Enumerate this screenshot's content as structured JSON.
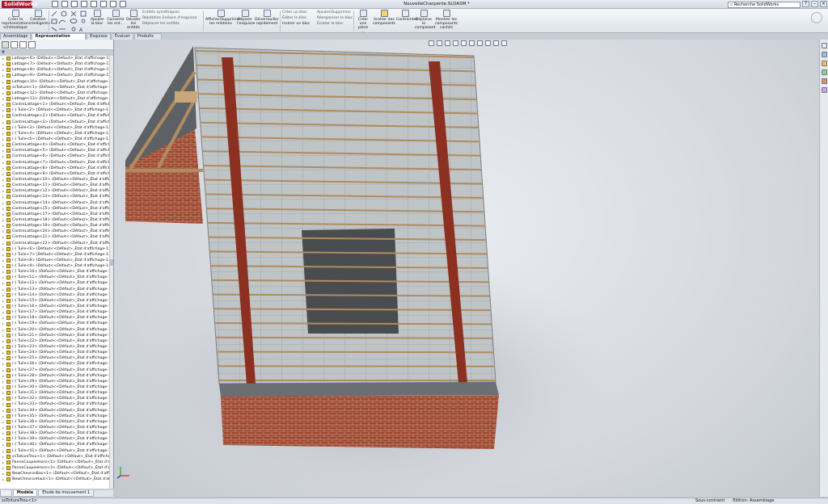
{
  "app": {
    "brand": "SolidWorks",
    "document_title": "NouvelleCharpente.SLDASM *",
    "search_placeholder": "Recherche SolidWorks"
  },
  "ribbon": {
    "buttons": [
      {
        "label": "Créer la représentation schématique"
      },
      {
        "label": "Cotation intelligente"
      },
      {
        "label": "Ajouter la bloc"
      },
      {
        "label": "Convertir les ent..."
      },
      {
        "label": "Décaler les entités"
      },
      {
        "label": "Afficher/Supprimer les relations"
      },
      {
        "label": "Réparer l'esquisse"
      },
      {
        "label": "Déverrouiller rapidement"
      },
      {
        "label": "Créer une pièce ..."
      },
      {
        "label": "Insérer des composants"
      },
      {
        "label": "Contraintes"
      },
      {
        "label": "Déplacer le composant"
      },
      {
        "label": "Montrer les composants cachés"
      }
    ],
    "small": [
      {
        "label": "Entités symétriques"
      },
      {
        "label": "Répétition linéaire d'esquisse"
      },
      {
        "label": "Déplacer les entités"
      },
      {
        "label": "Créer un bloc"
      },
      {
        "label": "Éditer le bloc"
      },
      {
        "label": "Insérer un bloc"
      },
      {
        "label": "Ajouter/Supprimer"
      },
      {
        "label": "Réorganiser le bloc"
      },
      {
        "label": "Éclater le bloc"
      }
    ]
  },
  "command_tabs": [
    "Assemblage",
    "Représentation schématique",
    "Esquisse",
    "Évaluer",
    "Produits Office"
  ],
  "tree": {
    "items": [
      "Lattage<6> (Défaut<<Défaut>_État d'affichage-1>)",
      "Lattage<7> (Défaut<<Défaut>_État d'affichage-1>)",
      "Lattage<8> (Défaut<<Défaut>_État d'affichage-1>)",
      "Lattage<9> (Défaut<<Défaut>_État d'affichage-1>)",
      "Lattage<10> (Défaut<<Défaut>_État d'affichage-1>)",
      "ssToiture<1> (Défaut<<Défaut>_État d'affichage-1>)",
      "Lattage<12> (Défaut<<Défaut>_État d'affichage-1>)",
      "Lattage<13> (Défaut<<Défaut>_État d'affichage-1>)",
      "ContreLattage<1> (Défaut<<Défaut>_État d'affichage-1",
      "(-) Tuile<2> (Défaut<<Défaut>_État d'affichage-1>)",
      "ContreLattage<2> (Défaut<<Défaut>_État d'affichage-1",
      "ContreLattage<3> (Défaut<<Défaut>_État d'affichage-1",
      "(-) Tuile<3> (Défaut<<Défaut>_État d'affichage-1>)",
      "(-) Tuile<4> (Défaut<<Défaut>_État d'affichage-1>)",
      "(-) Tuile<5> (Défaut<<Défaut>_État d'affichage-1>)",
      "ContreLattage<4> (Défaut<<Défaut>_État d'affichage-1",
      "ContreLattage<5> (Défaut<<Défaut>_État d'affichage-1",
      "ContreLattage<6> (Défaut<<Défaut>_État d'affichage-1",
      "ContreLattage<7> (Défaut<<Défaut>_État d'affichage-1",
      "ContreLattage<8> (Défaut<<Défaut>_État d'affichage-1",
      "ContreLattage<9> (Défaut<<Défaut>_État d'affichage-1",
      "ContreLattage<10> (Défaut<<Défaut>_État d'affichage",
      "ContreLattage<11> (Défaut<<Défaut>_État d'affichage",
      "ContreLattage<12> (Défaut<<Défaut>_État d'affichage",
      "ContreLattage<13> (Défaut<<Défaut>_État d'affichage",
      "ContreLattage<14> (Défaut<<Défaut>_État d'affichage",
      "ContreLattage<15> (Défaut<<Défaut>_État d'affichage",
      "ContreLattage<17> (Défaut<<Défaut>_État d'affichage",
      "ContreLattage<18> (Défaut<<Défaut>_État d'affichage",
      "ContreLattage<19> (Défaut<<Défaut>_État d'affichage",
      "ContreLattage<20> (Défaut<<Défaut>_État d'affichage",
      "ContreLattage<21> (Défaut<<Défaut>_État d'affichage",
      "ContreLattage<22> (Défaut<<Défaut>_État d'affichage",
      "(-) Tuile<6> (Défaut<<Défaut>_État d'affichage-1>)",
      "(-) Tuile<7> (Défaut<<Défaut>_État d'affichage-1>)",
      "(-) Tuile<8> (Défaut<<Défaut>_État d'affichage-1>)",
      "(-) Tuile<9> (Défaut<<Défaut>_État d'affichage-1>)",
      "(-) Tuile<10> (Défaut<<Défaut>_État d'affichage-1>)",
      "(-) Tuile<11> (Défaut<<Défaut>_État d'affichage-1>)",
      "(-) Tuile<12> (Défaut<<Défaut>_État d'affichage-1>)",
      "(-) Tuile<13> (Défaut<<Défaut>_État d'affichage-1>)",
      "(-) Tuile<14> (Défaut<<Défaut>_État d'affichage-1>)",
      "(-) Tuile<15> (Défaut<<Défaut>_État d'affichage-1>)",
      "(-) Tuile<16> (Défaut<<Défaut>_État d'affichage-1>)",
      "(-) Tuile<17> (Défaut<<Défaut>_État d'affichage-1>)",
      "(-) Tuile<18> (Défaut<<Défaut>_État d'affichage-1>)",
      "(-) Tuile<19> (Défaut<<Défaut>_État d'affichage-1>)",
      "(-) Tuile<20> (Défaut<<Défaut>_État d'affichage-1>)",
      "(-) Tuile<21> (Défaut<<Défaut>_État d'affichage-1>)",
      "(-) Tuile<22> (Défaut<<Défaut>_État d'affichage-1>)",
      "(-) Tuile<23> (Défaut<<Défaut>_État d'affichage-1>)",
      "(-) Tuile<24> (Défaut<<Défaut>_État d'affichage-1>)",
      "(-) Tuile<25> (Défaut<<Défaut>_État d'affichage-1>)",
      "(-) Tuile<26> (Défaut<<Défaut>_État d'affichage-1>)",
      "(-) Tuile<27> (Défaut<<Défaut>_État d'affichage-1>)",
      "(-) Tuile<28> (Défaut<<Défaut>_État d'affichage-1>)",
      "(-) Tuile<29> (Défaut<<Défaut>_État d'affichage-1>)",
      "(-) Tuile<30> (Défaut<<Défaut>_État d'affichage-1>)",
      "(-) Tuile<31> (Défaut<<Défaut>_État d'affichage-1>)",
      "(-) Tuile<32> (Défaut<<Défaut>_État d'affichage-1>)",
      "(-) Tuile<33> (Défaut<<Défaut>_État d'affichage-1>)",
      "(-) Tuile<34> (Défaut<<Défaut>_État d'affichage-1>)",
      "(-) Tuile<35> (Défaut<<Défaut>_État d'affichage-1>)",
      "(-) Tuile<36> (Défaut<<Défaut>_État d'affichage-1>)",
      "(-) Tuile<37> (Défaut<<Défaut>_État d'affichage-1>)",
      "(-) Tuile<38> (Défaut<<Défaut>_État d'affichage-1>)",
      "(-) Tuile<39> (Défaut<<Défaut>_État d'affichage-1>)",
      "(-) Tuile<40> (Défaut<<Défaut>_État d'affichage-1>)",
      "(-) Tuile<41> (Défaut<<Défaut>_État d'affichage-1>)",
      "ssToitureTrou<1> (Défaut<<Défaut>_État d'affichage-1",
      "PanneCoupeeHorz<1> (Défaut<<Défaut>_État d'affich",
      "PanneCoupeeHorz<3> (Défaut<<Défaut>_État d'affich",
      "NewChevronBas<1> (Défaut<<Défaut>_État d'affichag",
      "NewChevronHaut<1> (Défaut<<Défaut>_État d'affichag"
    ]
  },
  "bottom_tabs": [
    "Modèle",
    "Étude de mouvement 1"
  ],
  "status": {
    "left": "ssToitureTrou<1>",
    "mode": "Sous-contraint",
    "editing": "Edition: Assemblage"
  },
  "colors": {
    "brick": "#a0472e",
    "tile": "#bfc4c7",
    "batten": "#b08c5e",
    "rafter_red": "#8c3022",
    "wood": "#c9a77a"
  }
}
